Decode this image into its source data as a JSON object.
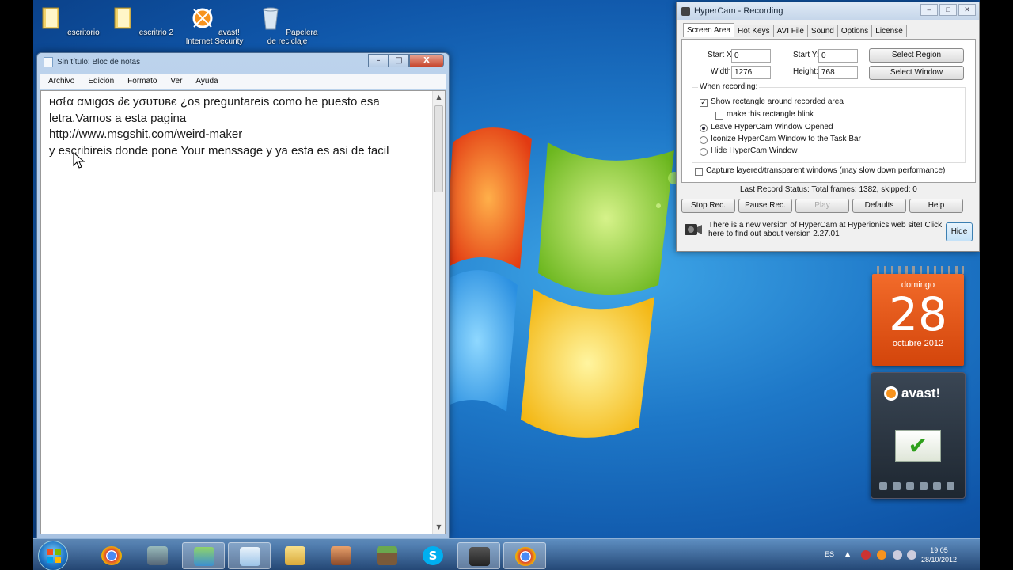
{
  "desktop": {
    "icons": [
      {
        "label": "escritorio"
      },
      {
        "label": "escritrio 2"
      },
      {
        "label": "avast! Internet Security"
      },
      {
        "label": "Papelera de reciclaje"
      }
    ]
  },
  "notepad": {
    "title": "Sin título: Bloc de notas",
    "menu": [
      "Archivo",
      "Edición",
      "Formato",
      "Ver",
      "Ayuda"
    ],
    "content": "ʜσℓα αмιgσѕ ∂є уσυтυвє ¿os preguntareis como he puesto esa letra.Vamos a esta pagina\nhttp://www.msgshit.com/weird-maker\ny escribireis donde pone Your menssage y ya esta es asi de facil",
    "window_buttons": {
      "min": "–",
      "max": "□",
      "close": "X"
    }
  },
  "hypercam": {
    "title": "HyperCam - Recording",
    "tabs": [
      "Screen Area",
      "Hot Keys",
      "AVI File",
      "Sound",
      "Options",
      "License"
    ],
    "active_tab": "Screen Area",
    "start_x_label": "Start X:",
    "start_x": "0",
    "start_y_label": "Start Y:",
    "start_y": "0",
    "width_label": "Width:",
    "width": "1276",
    "height_label": "Height:",
    "height": "768",
    "select_region": "Select Region",
    "select_window": "Select Window",
    "when_recording": "When recording:",
    "show_rect": "Show rectangle around recorded area",
    "blink_rect": "make this rectangle blink",
    "leave_opened": "Leave HyperCam Window Opened",
    "iconize": "Iconize HyperCam Window to the Task Bar",
    "hide_window": "Hide HyperCam Window",
    "capture_layered": "Capture layered/transparent windows (may slow down performance)",
    "status": "Last Record Status: Total frames: 1382, skipped: 0",
    "buttons": {
      "stop": "Stop Rec.",
      "pause": "Pause Rec.",
      "play": "Play",
      "defaults": "Defaults",
      "help": "Help"
    },
    "update_msg": "There is a new version of HyperCam at Hyperionics web site! Click here to find out about version 2.27.01",
    "hide_btn": "Hide"
  },
  "calendar": {
    "weekday": "domingo",
    "day": "28",
    "month_year": "octubre 2012"
  },
  "avast_gadget": {
    "brand": "avast!"
  },
  "taskbar": {
    "language": "ES",
    "time": "19:05",
    "date": "28/10/2012"
  },
  "colors": {
    "calendar": "#e85a1a",
    "avast_accent": "#f7931e"
  }
}
